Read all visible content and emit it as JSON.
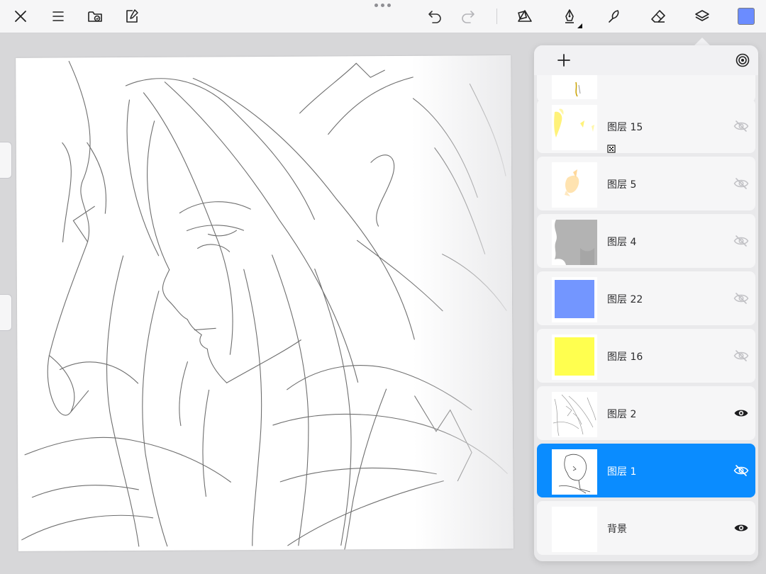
{
  "toolbar": {
    "left_icons": [
      "close-icon",
      "menu-icon",
      "gallery-icon",
      "export-icon"
    ],
    "right_icons": [
      "undo-icon",
      "redo-icon",
      "shape-icon",
      "pen-icon",
      "smudge-icon",
      "eraser-icon",
      "layers-icon"
    ],
    "current_color": "#6b8cff"
  },
  "layers_panel": {
    "add_icon": "plus-icon",
    "mode_icon": "layer-mode-icon",
    "layers": [
      {
        "name": "",
        "visible": false,
        "selected": false,
        "thumb": "partial-sketch"
      },
      {
        "name": "图层 15",
        "visible": false,
        "selected": false,
        "thumb": "yellow-specks",
        "clipping_icon": "clip-icon"
      },
      {
        "name": "图层 5",
        "visible": false,
        "selected": false,
        "thumb": "peach-specks"
      },
      {
        "name": "图层 4",
        "visible": false,
        "selected": false,
        "thumb": "gray-silhouette"
      },
      {
        "name": "图层 22",
        "visible": false,
        "selected": false,
        "thumb": "solid",
        "thumb_color": "#7396ff"
      },
      {
        "name": "图层 16",
        "visible": false,
        "selected": false,
        "thumb": "solid",
        "thumb_color": "#ffff4f"
      },
      {
        "name": "图层 2",
        "visible": true,
        "selected": false,
        "thumb": "sketch"
      },
      {
        "name": "图层 1",
        "visible": false,
        "selected": true,
        "thumb": "face-sketch"
      },
      {
        "name": "背景",
        "visible": true,
        "selected": false,
        "thumb": "blank"
      }
    ]
  },
  "colors": {
    "selection": "#0a8cff",
    "panel_bg": "#e9e9eb",
    "layer_bg": "#f6f6f7"
  }
}
